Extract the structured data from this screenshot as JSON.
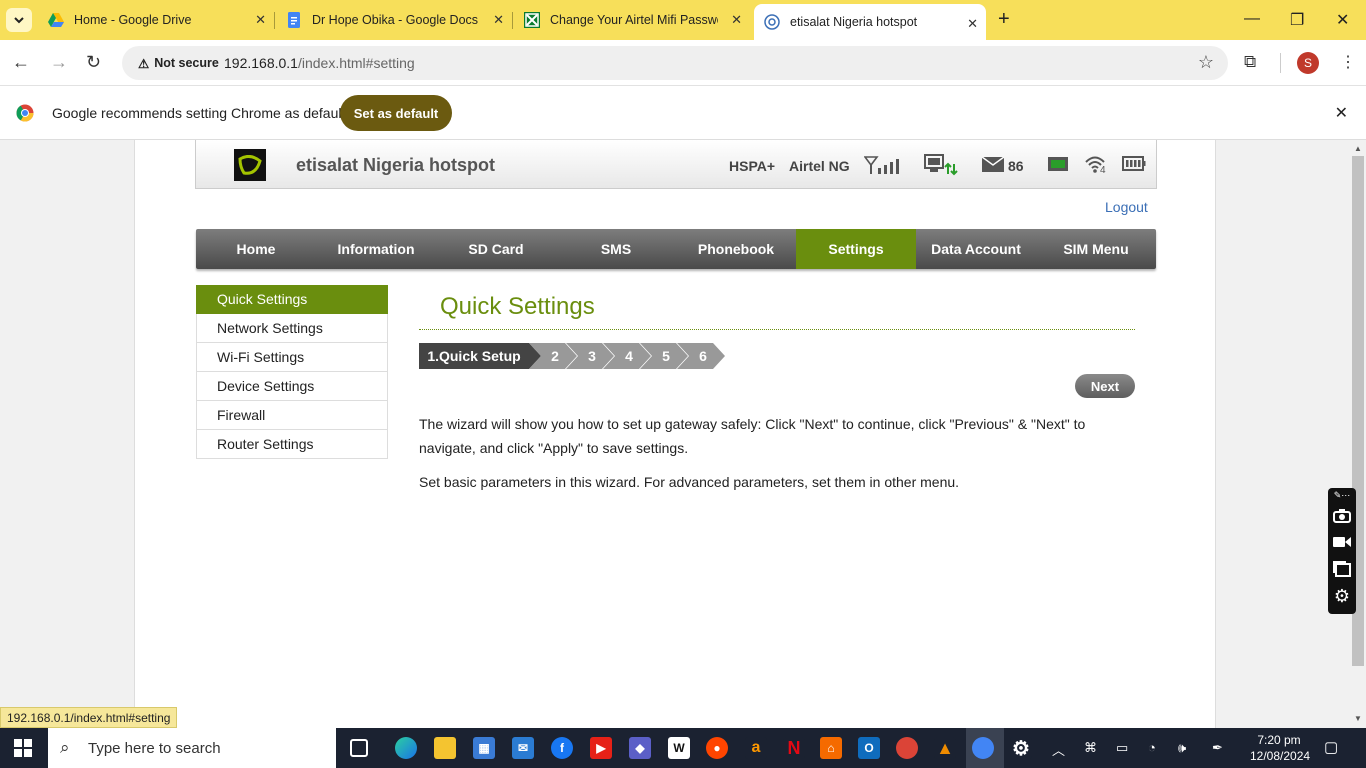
{
  "browser": {
    "tabs": [
      {
        "title": "Home - Google Drive",
        "icon": "google-drive-icon"
      },
      {
        "title": "Dr Hope Obika - Google Docs",
        "icon": "google-docs-icon"
      },
      {
        "title": "Change Your Airtel Mifi Passwo",
        "icon": "sheets-icon"
      },
      {
        "title": "etisalat Nigeria hotspot",
        "icon": "globe-icon",
        "active": true
      }
    ],
    "new_tab": "+",
    "address": {
      "security_label": "Not secure",
      "host": "192.168.0.1",
      "path": "/index.html#setting"
    },
    "profile_initial": "S",
    "infobar": {
      "message": "Google recommends setting Chrome as default",
      "button": "Set as default"
    },
    "status_url": "192.168.0.1/index.html#setting"
  },
  "router": {
    "title": "etisalat Nigeria hotspot",
    "network_type": "HSPA+",
    "operator": "Airtel NG",
    "sms_count": "86",
    "wifi_clients": "4",
    "logout": "Logout",
    "nav": [
      "Home",
      "Information",
      "SD Card",
      "SMS",
      "Phonebook",
      "Settings",
      "Data Account",
      "SIM Menu"
    ],
    "active_nav": "Settings",
    "side_menu": [
      "Quick Settings",
      "Network Settings",
      "Wi-Fi Settings",
      "Device Settings",
      "Firewall",
      "Router Settings"
    ],
    "active_side": "Quick Settings",
    "content": {
      "heading": "Quick Settings",
      "steps": [
        "1.Quick Setup",
        "2",
        "3",
        "4",
        "5",
        "6"
      ],
      "next_button": "Next",
      "paragraph1": "The wizard will show you how to set up gateway safely: Click \"Next\" to continue, click \"Previous\" & \"Next\" to navigate, and click \"Apply\" to save settings.",
      "paragraph2": "Set basic parameters in this wizard. For advanced parameters, set them in other menu."
    },
    "accent_color": "#6a8e0e"
  },
  "taskbar": {
    "search_placeholder": "Type here to search",
    "time": "7:20 pm",
    "date": "12/08/2024"
  }
}
